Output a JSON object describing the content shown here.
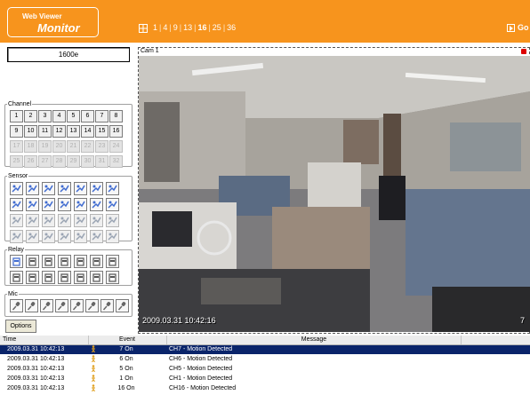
{
  "header": {
    "logo_line1": "Web Viewer",
    "logo_line2": "Monitor",
    "layouts": [
      "1",
      "4",
      "9",
      "13",
      "16",
      "25",
      "36"
    ],
    "active_layout": "16",
    "go_label": "Go"
  },
  "site_name": "1600e",
  "channel": {
    "legend": "Channel",
    "buttons": [
      "1",
      "2",
      "3",
      "4",
      "5",
      "6",
      "7",
      "8",
      "9",
      "10",
      "11",
      "12",
      "13",
      "14",
      "15",
      "16",
      "17",
      "18",
      "19",
      "20",
      "21",
      "22",
      "23",
      "24",
      "25",
      "26",
      "27",
      "28",
      "29",
      "30",
      "31",
      "32"
    ]
  },
  "sensor": {
    "legend": "Sensor"
  },
  "relay": {
    "legend": "Relay"
  },
  "mic": {
    "legend": "Mic"
  },
  "options_label": "Options",
  "camera": {
    "label": "Cam 1",
    "timestamp": "2009.03.31 10:42:16",
    "corner_text": "7"
  },
  "events": {
    "columns": {
      "time": "Time",
      "event": "Event",
      "message": "Message"
    },
    "rows": [
      {
        "time": "2009.03.31 10:42:13",
        "event": "7 On",
        "message": "CH7 - Motion Detected"
      },
      {
        "time": "2009.03.31 10:42:13",
        "event": "6 On",
        "message": "CH6 - Motion Detected"
      },
      {
        "time": "2009.03.31 10:42:13",
        "event": "5 On",
        "message": "CH5 - Motion Detected"
      },
      {
        "time": "2009.03.31 10:42:13",
        "event": "1 On",
        "message": "CH1 - Motion Detected"
      },
      {
        "time": "2009.03.31 10:42:13",
        "event": "16 On",
        "message": "CH16 - Motion Detected"
      }
    ]
  },
  "colors": {
    "header": "#f7941d",
    "selection": "#0a246a"
  }
}
